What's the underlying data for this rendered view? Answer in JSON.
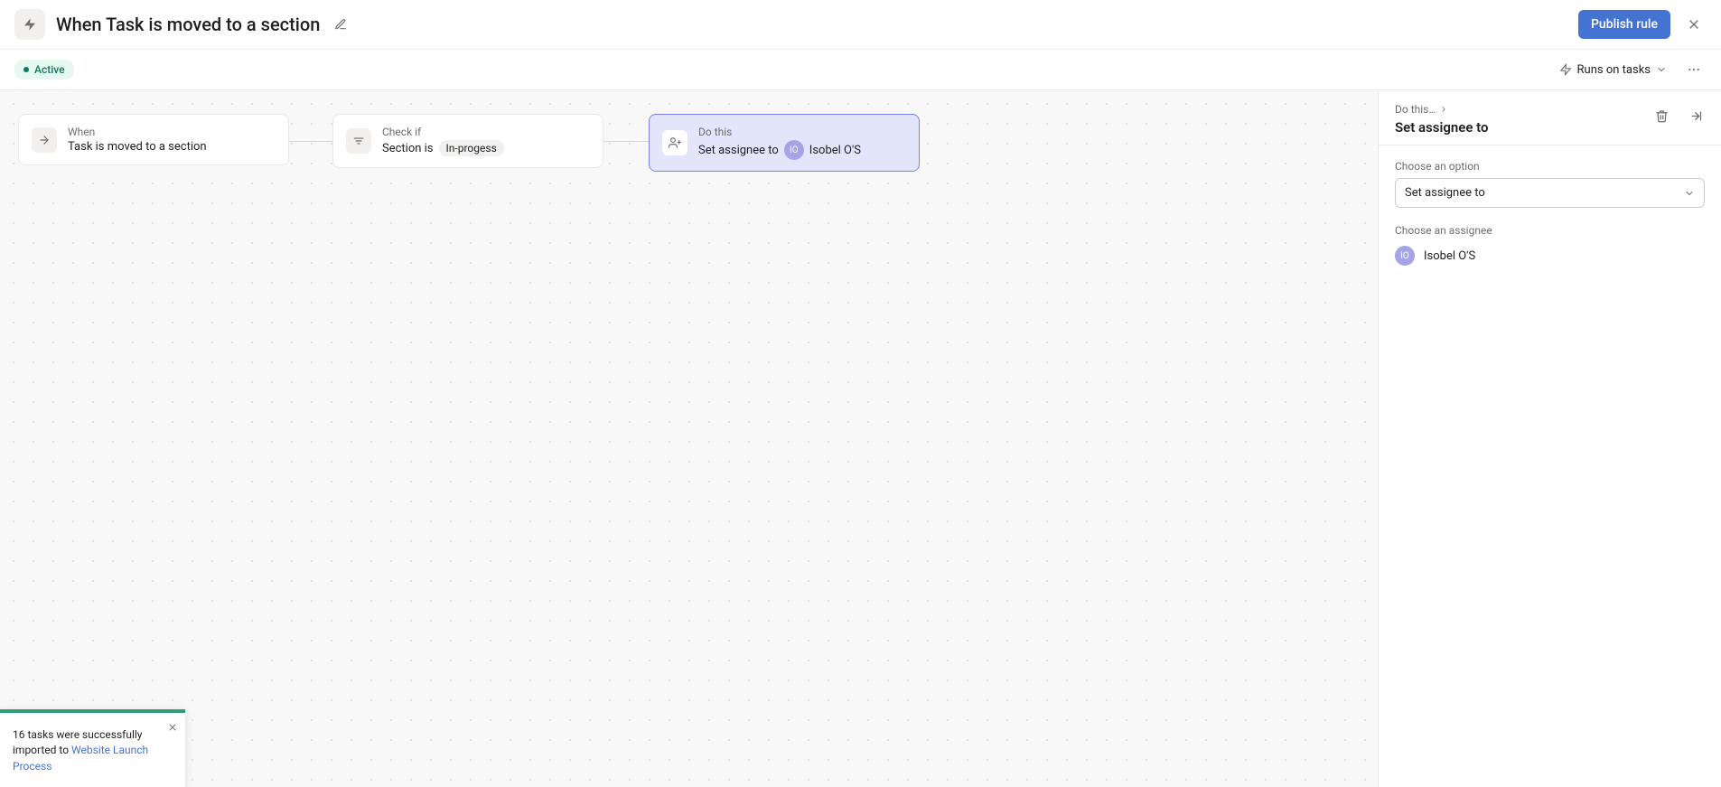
{
  "header": {
    "title": "When Task is moved to a section",
    "publish_label": "Publish rule"
  },
  "subheader": {
    "status_label": "Active",
    "runs_on_label": "Runs on tasks"
  },
  "canvas": {
    "trigger": {
      "label": "When",
      "title": "Task is moved to a section"
    },
    "condition": {
      "label": "Check if",
      "title_prefix": "Section is",
      "tag": "In-progess"
    },
    "action": {
      "label": "Do this",
      "title_prefix": "Set assignee to",
      "assignee_initials": "IO",
      "assignee_name": "Isobel O'S"
    }
  },
  "panel": {
    "breadcrumb": "Do this…",
    "title": "Set assignee to",
    "option_label": "Choose an option",
    "select_value": "Set assignee to",
    "assignee_label": "Choose an assignee",
    "assignee_initials": "IO",
    "assignee_name": "Isobel O'S"
  },
  "toast": {
    "text_prefix": "16 tasks were successfully imported to ",
    "link_text": "Website Launch Process"
  }
}
